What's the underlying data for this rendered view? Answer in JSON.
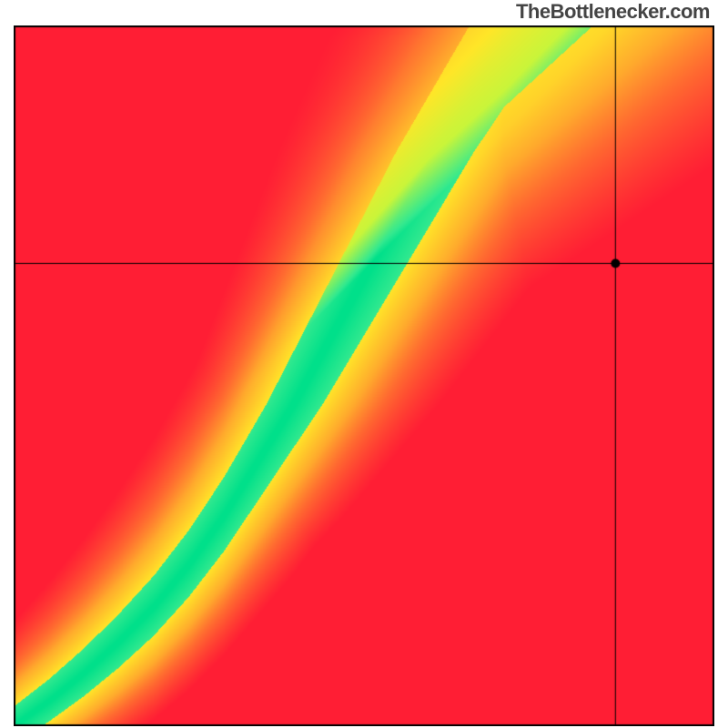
{
  "title": "TheBottlenecker.com",
  "chart_data": {
    "type": "heatmap",
    "title": "TheBottlenecker.com",
    "xlabel": "",
    "ylabel": "",
    "xlim": [
      0,
      1
    ],
    "ylim": [
      0,
      1
    ],
    "marker": {
      "x": 0.86,
      "y": 0.66
    },
    "optimal_curve": [
      {
        "x": 0.0,
        "y": 0.0
      },
      {
        "x": 0.05,
        "y": 0.035
      },
      {
        "x": 0.1,
        "y": 0.075
      },
      {
        "x": 0.15,
        "y": 0.12
      },
      {
        "x": 0.2,
        "y": 0.17
      },
      {
        "x": 0.25,
        "y": 0.23
      },
      {
        "x": 0.3,
        "y": 0.3
      },
      {
        "x": 0.35,
        "y": 0.38
      },
      {
        "x": 0.4,
        "y": 0.46
      },
      {
        "x": 0.45,
        "y": 0.55
      },
      {
        "x": 0.5,
        "y": 0.64
      },
      {
        "x": 0.55,
        "y": 0.73
      },
      {
        "x": 0.6,
        "y": 0.82
      },
      {
        "x": 0.65,
        "y": 0.9
      },
      {
        "x": 0.7,
        "y": 0.98
      },
      {
        "x": 0.72,
        "y": 1.0
      }
    ],
    "band_width_factor": 0.1,
    "colorscale": [
      {
        "pos": 0.0,
        "color": "#ff1e34"
      },
      {
        "pos": 0.3,
        "color": "#ff6a30"
      },
      {
        "pos": 0.55,
        "color": "#ffb12c"
      },
      {
        "pos": 0.75,
        "color": "#ffe628"
      },
      {
        "pos": 0.9,
        "color": "#c9f53a"
      },
      {
        "pos": 0.98,
        "color": "#33e98f"
      },
      {
        "pos": 1.0,
        "color": "#00e08a"
      }
    ],
    "grid": false,
    "axes_visible": false,
    "crosshair": true,
    "border": true
  }
}
